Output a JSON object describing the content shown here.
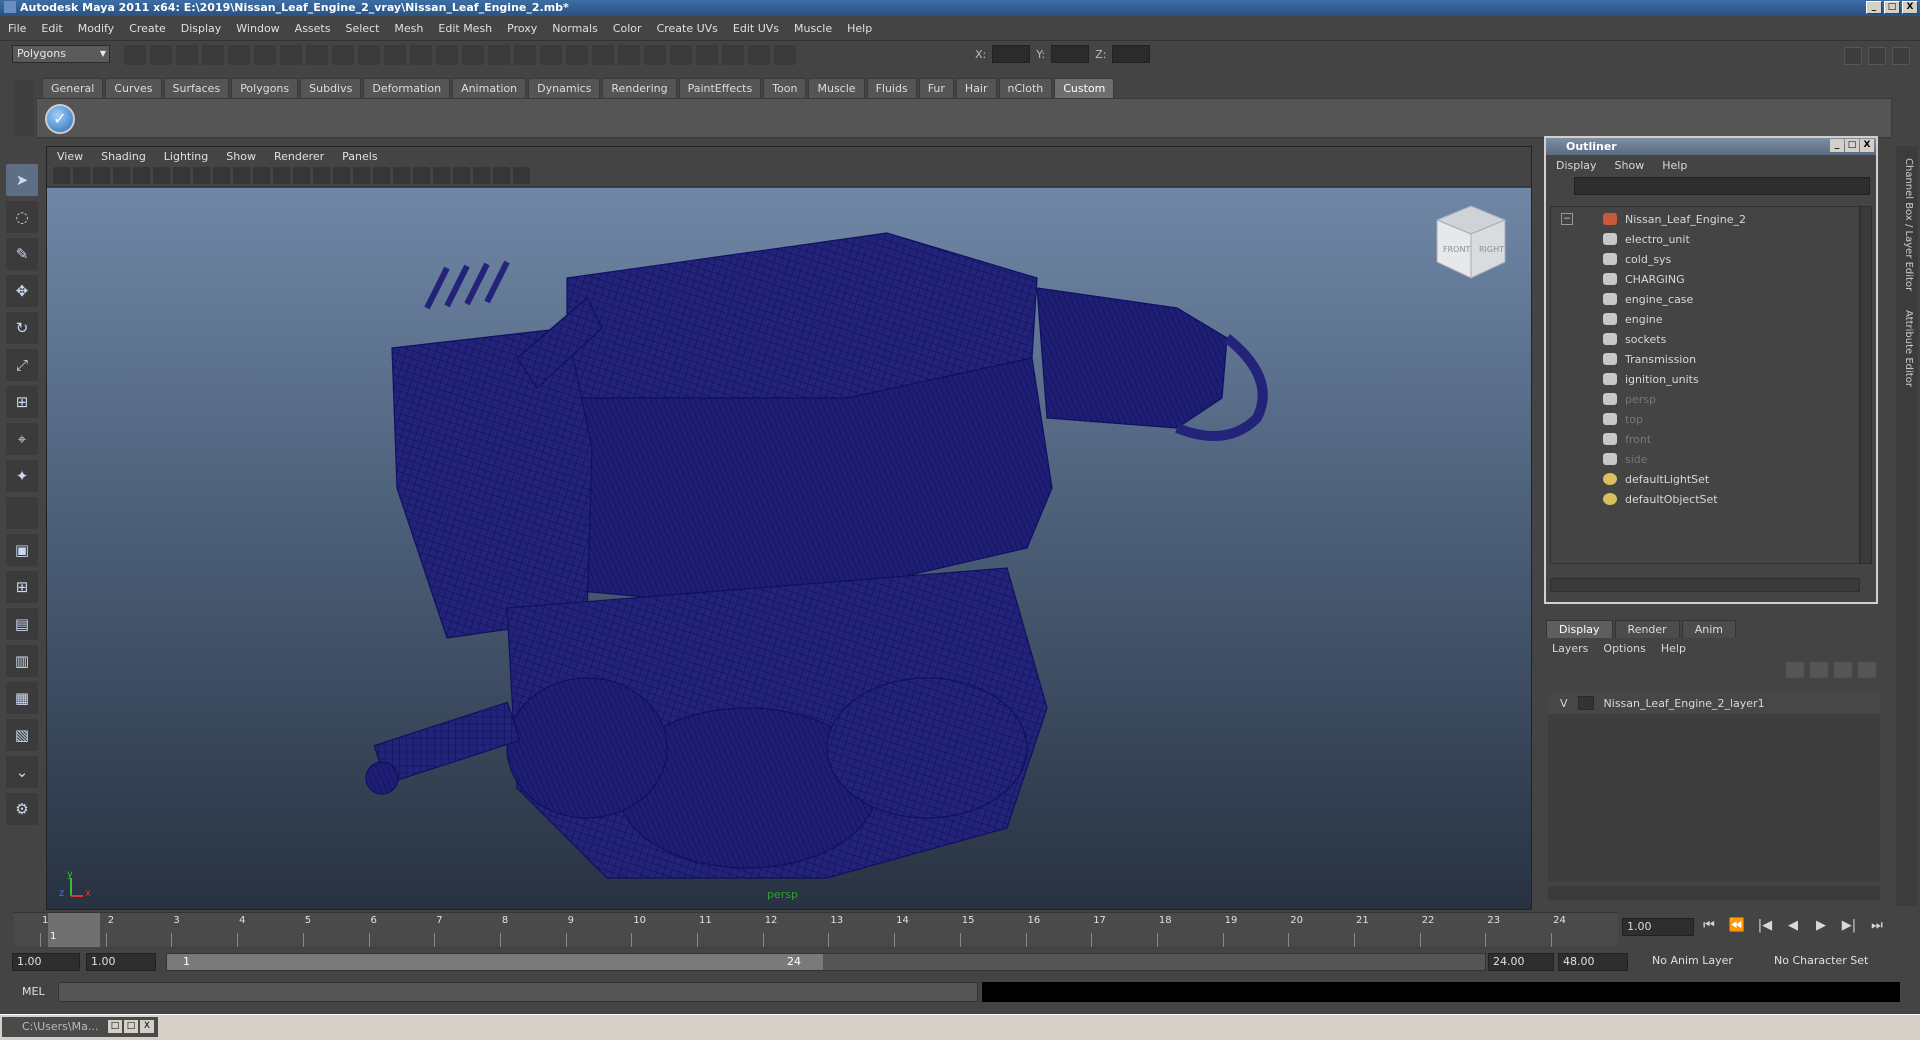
{
  "app": {
    "title": "Autodesk Maya 2011 x64: E:\\2019\\Nissan_Leaf_Engine_2_vray\\Nissan_Leaf_Engine_2.mb*",
    "window_buttons": [
      "_",
      "□",
      "X"
    ]
  },
  "menubar": [
    "File",
    "Edit",
    "Modify",
    "Create",
    "Display",
    "Window",
    "Assets",
    "Select",
    "Mesh",
    "Edit Mesh",
    "Proxy",
    "Normals",
    "Color",
    "Create UVs",
    "Edit UVs",
    "Muscle",
    "Help"
  ],
  "statusline": {
    "mode": "Polygons",
    "x_label": "X:",
    "y_label": "Y:",
    "z_label": "Z:"
  },
  "shelf": {
    "tabs": [
      "General",
      "Curves",
      "Surfaces",
      "Polygons",
      "Subdivs",
      "Deformation",
      "Animation",
      "Dynamics",
      "Rendering",
      "PaintEffects",
      "Toon",
      "Muscle",
      "Fluids",
      "Fur",
      "Hair",
      "nCloth",
      "Custom"
    ],
    "active_tab": "Custom",
    "shelf_icon": "checkmark-icon"
  },
  "viewport": {
    "menu": [
      "View",
      "Shading",
      "Lighting",
      "Show",
      "Renderer",
      "Panels"
    ],
    "camera": "persp",
    "viewcube": {
      "front": "FRONT",
      "right": "RIGHT"
    },
    "axis": {
      "y": "y",
      "x": "x",
      "z": "z"
    },
    "wire_color": "#1a1a7a"
  },
  "outliner": {
    "title": "Outliner",
    "menu": [
      "Display",
      "Show",
      "Help"
    ],
    "collapse_toggle": "−",
    "root": "Nissan_Leaf_Engine_2",
    "children": [
      "electro_unit",
      "cold_sys",
      "CHARGING",
      "engine_case",
      "engine",
      "sockets",
      "Transmission",
      "ignition_units"
    ],
    "cameras": [
      "persp",
      "top",
      "front",
      "side"
    ],
    "sets": [
      "defaultLightSet",
      "defaultObjectSet"
    ]
  },
  "layer_editor": {
    "tabs": [
      "Display",
      "Render",
      "Anim"
    ],
    "active_tab": "Display",
    "menu": [
      "Layers",
      "Options",
      "Help"
    ],
    "layers": [
      {
        "visible": "V",
        "name": "Nissan_Leaf_Engine_2_layer1"
      }
    ]
  },
  "side_tabs": [
    "Channel Box / Layer Editor",
    "Attribute Editor"
  ],
  "timeline": {
    "ticks": [
      "1",
      "2",
      "3",
      "4",
      "5",
      "6",
      "7",
      "8",
      "9",
      "10",
      "11",
      "12",
      "13",
      "14",
      "15",
      "16",
      "17",
      "18",
      "19",
      "20",
      "21",
      "22",
      "23",
      "24"
    ],
    "current_frame": "1",
    "current_frame_field": "1.00",
    "play_controls": [
      "⏮",
      "⏪",
      "|◀",
      "◀",
      "▶",
      "▶|",
      "⏭"
    ]
  },
  "range": {
    "start": "1.00",
    "playback_start": "1.00",
    "slider_start": "1",
    "slider_end": "24",
    "playback_end": "24.00",
    "end": "48.00",
    "anim_layer": "No Anim Layer",
    "character_set": "No Character Set"
  },
  "command_line": {
    "label": "MEL"
  },
  "taskbar": {
    "item": "C:\\Users\\Ma..."
  }
}
